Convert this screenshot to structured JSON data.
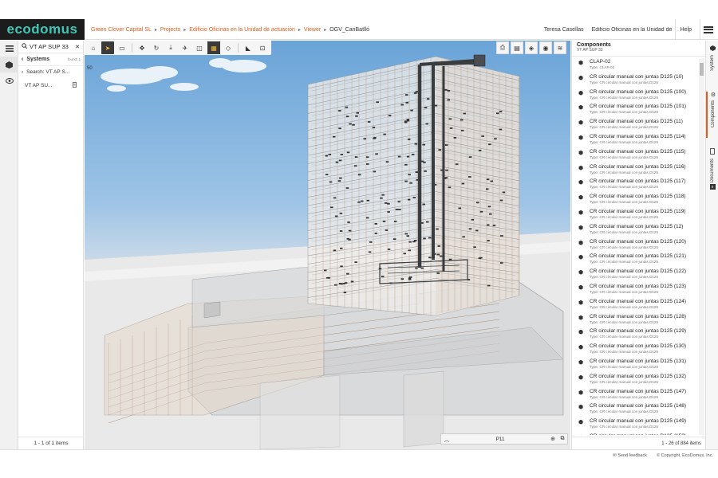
{
  "app": {
    "logo": "ecodomus"
  },
  "breadcrumb": [
    "Green Clover Capital SL",
    "Projects",
    "Edificio Oficinas en la Unidad de actuación",
    "Viewer",
    "OGV_CanBatlló"
  ],
  "header": {
    "user": "Teresa Casellas",
    "project": "Edificio Oficinas en la Unidad de actuación",
    "help": "Help"
  },
  "left_panel": {
    "search_value": "VT AP SUP 33",
    "systems_label": "Systems",
    "found_label": "found: 1",
    "search_label": "Search: VT AP S...",
    "items": [
      "VT AP SU..."
    ],
    "footer": "1 - 1 of 1 items"
  },
  "viewer": {
    "fov": "50",
    "floor": "P11",
    "toolbar": [
      "home-icon",
      "select-icon",
      "measure-icon",
      "pan-icon",
      "orbit-icon",
      "walk-icon",
      "fly-icon",
      "section-icon",
      "xray-icon",
      "focus-icon",
      "hide-icon",
      "isolate-icon"
    ],
    "toolbar_right": [
      "export-icon",
      "chart-icon",
      "cube-icon",
      "layers-icon",
      "filter-icon"
    ]
  },
  "right_panel": {
    "title": "Components",
    "subtitle": "VT AP SUP 33",
    "items": [
      {
        "name": "CLAP-02",
        "type": "Type: CLAP-02"
      },
      {
        "name": "CR circular manual con juntas D125 (10)",
        "type": "Type: CR circular manual con juntas D125"
      },
      {
        "name": "CR circular manual con juntas D125 (100)",
        "type": "Type: CR circular manual con juntas D125"
      },
      {
        "name": "CR circular manual con juntas D125 (101)",
        "type": "Type: CR circular manual con juntas D125"
      },
      {
        "name": "CR circular manual con juntas D125 (11)",
        "type": "Type: CR circular manual con juntas D125"
      },
      {
        "name": "CR circular manual con juntas D125 (114)",
        "type": "Type: CR circular manual con juntas D125"
      },
      {
        "name": "CR circular manual con juntas D125 (115)",
        "type": "Type: CR circular manual con juntas D125"
      },
      {
        "name": "CR circular manual con juntas D125 (116)",
        "type": "Type: CR circular manual con juntas D125"
      },
      {
        "name": "CR circular manual con juntas D125 (117)",
        "type": "Type: CR circular manual con juntas D125"
      },
      {
        "name": "CR circular manual con juntas D125 (118)",
        "type": "Type: CR circular manual con juntas D125"
      },
      {
        "name": "CR circular manual con juntas D125 (119)",
        "type": "Type: CR circular manual con juntas D125"
      },
      {
        "name": "CR circular manual con juntas D125 (12)",
        "type": "Type: CR circular manual con juntas D125"
      },
      {
        "name": "CR circular manual con juntas D125 (120)",
        "type": "Type: CR circular manual con juntas D125"
      },
      {
        "name": "CR circular manual con juntas D125 (121)",
        "type": "Type: CR circular manual con juntas D125"
      },
      {
        "name": "CR circular manual con juntas D125 (122)",
        "type": "Type: CR circular manual con juntas D125"
      },
      {
        "name": "CR circular manual con juntas D125 (123)",
        "type": "Type: CR circular manual con juntas D125"
      },
      {
        "name": "CR circular manual con juntas D125 (124)",
        "type": "Type: CR circular manual con juntas D125"
      },
      {
        "name": "CR circular manual con juntas D125 (128)",
        "type": "Type: CR circular manual con juntas D125"
      },
      {
        "name": "CR circular manual con juntas D125 (129)",
        "type": "Type: CR circular manual con juntas D125"
      },
      {
        "name": "CR circular manual con juntas D125 (130)",
        "type": "Type: CR circular manual con juntas D125"
      },
      {
        "name": "CR circular manual con juntas D125 (131)",
        "type": "Type: CR circular manual con juntas D125"
      },
      {
        "name": "CR circular manual con juntas D125 (132)",
        "type": "Type: CR circular manual con juntas D125"
      },
      {
        "name": "CR circular manual con juntas D125 (147)",
        "type": "Type: CR circular manual con juntas D125"
      },
      {
        "name": "CR circular manual con juntas D125 (148)",
        "type": "Type: CR circular manual con juntas D125"
      },
      {
        "name": "CR circular manual con juntas D125 (149)",
        "type": "Type: CR circular manual con juntas D125"
      },
      {
        "name": "CR circular manual con juntas D125 (150)",
        "type": "Type: CR circular manual con juntas D125"
      }
    ],
    "footer": "1 - 26 of 884 items"
  },
  "right_tabs": [
    {
      "label": "System"
    },
    {
      "label": "Components"
    },
    {
      "label": "Documents",
      "badge": "0"
    }
  ],
  "status": {
    "feedback": "Send feedback",
    "copyright": "© Copyright, EcoDomus, Inc."
  },
  "colors": {
    "accent": "#e05a1a",
    "logo": "#3fc7b7",
    "logo_bg": "#1c1c1c"
  }
}
